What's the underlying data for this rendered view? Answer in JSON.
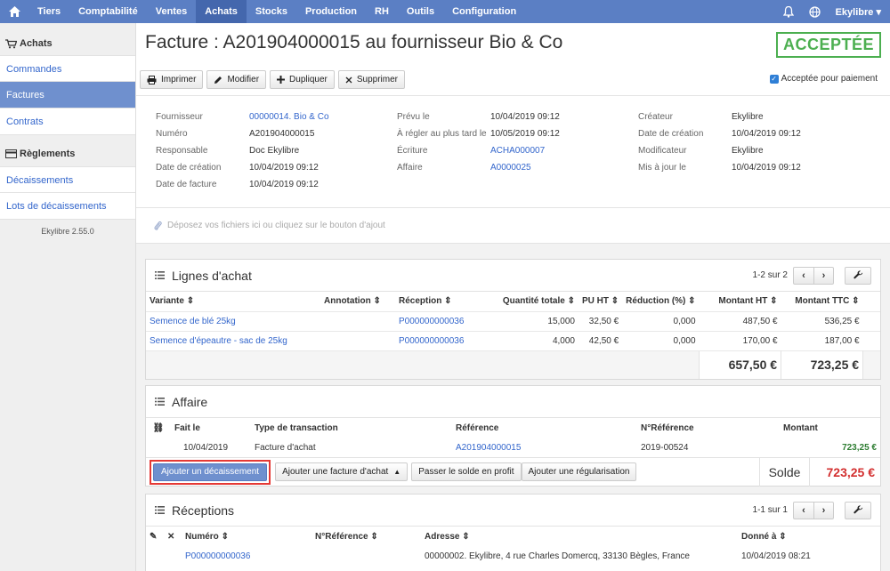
{
  "nav": {
    "items": [
      "Tiers",
      "Comptabilité",
      "Ventes",
      "Achats",
      "Stocks",
      "Production",
      "RH",
      "Outils",
      "Configuration"
    ],
    "active": "Achats",
    "user": "Ekylibre"
  },
  "sidebar": {
    "achats_title": "Achats",
    "achats_items": [
      "Commandes",
      "Factures",
      "Contrats"
    ],
    "reglements_title": "Règlements",
    "reglements_items": [
      "Décaissements",
      "Lots de décaissements"
    ],
    "version": "Ekylibre 2.55.0"
  },
  "header": {
    "title": "Facture : A201904000015 au fournisseur Bio & Co",
    "status": "ACCEPTÉE",
    "buttons": {
      "print": "Imprimer",
      "edit": "Modifier",
      "duplicate": "Dupliquer",
      "delete": "Supprimer"
    },
    "accepted_for_payment": "Acceptée pour paiement"
  },
  "details": {
    "col1": [
      {
        "label": "Fournisseur",
        "value": "00000014. Bio & Co",
        "link": true
      },
      {
        "label": "Numéro",
        "value": "A201904000015",
        "link": false
      },
      {
        "label": "Responsable",
        "value": "Doc Ekylibre",
        "link": false
      },
      {
        "label": "Date de création",
        "value": "10/04/2019 09:12",
        "link": false
      },
      {
        "label": "Date de facture",
        "value": "10/04/2019 09:12",
        "link": false
      }
    ],
    "col2": [
      {
        "label": "Prévu le",
        "value": "10/04/2019 09:12",
        "link": false
      },
      {
        "label": "À régler au plus tard le",
        "value": "10/05/2019 09:12",
        "link": false
      },
      {
        "label": "Écriture",
        "value": "ACHA000007",
        "link": true
      },
      {
        "label": "Affaire",
        "value": "A0000025",
        "link": true
      }
    ],
    "col3": [
      {
        "label": "Créateur",
        "value": "Ekylibre",
        "link": false
      },
      {
        "label": "Date de création",
        "value": "10/04/2019 09:12",
        "link": false
      },
      {
        "label": "Modificateur",
        "value": "Ekylibre",
        "link": false
      },
      {
        "label": "Mis à jour le",
        "value": "10/04/2019 09:12",
        "link": false
      }
    ]
  },
  "dropzone": "Déposez vos fichiers ici ou cliquez sur le bouton d'ajout",
  "lines": {
    "title": "Lignes d'achat",
    "pager": "1-2 sur 2",
    "columns": [
      "Variante",
      "Annotation",
      "Réception",
      "Quantité totale",
      "PU HT",
      "Réduction (%)",
      "Montant HT",
      "Montant TTC"
    ],
    "rows": [
      [
        "Semence de blé 25kg",
        "",
        "P000000000036",
        "15,000",
        "32,50 €",
        "0,000",
        "487,50 €",
        "536,25 €"
      ],
      [
        "Semence d'épeautre - sac de 25kg",
        "",
        "P000000000036",
        "4,000",
        "42,50 €",
        "0,000",
        "170,00 €",
        "187,00 €"
      ]
    ],
    "total_ht": "657,50 €",
    "total_ttc": "723,25 €"
  },
  "affaire": {
    "title": "Affaire",
    "columns": [
      "Fait le",
      "Type de transaction",
      "Référence",
      "N°Référence",
      "Montant"
    ],
    "row": [
      "10/04/2019",
      "Facture d'achat",
      "A201904000015",
      "2019-00524",
      "723,25 €"
    ],
    "buttons": {
      "add_payment": "Ajouter un décaissement",
      "add_invoice": "Ajouter une facture d'achat",
      "profit": "Passer le solde en profit",
      "regularisation": "Ajouter une régularisation"
    },
    "balance_label": "Solde",
    "balance_value": "723,25 €"
  },
  "receptions": {
    "title": "Réceptions",
    "pager": "1-1 sur 1",
    "columns": [
      "Numéro",
      "N°Référence",
      "Adresse",
      "Donné à"
    ],
    "row": [
      "P000000000036",
      "",
      "00000002. Ekylibre, 4 rue Charles Domercq, 33130 Bègles, France",
      "10/04/2019 08:21"
    ]
  },
  "colors": {
    "nav": "#5b7fc4",
    "accent": "#3366cc",
    "accepted": "#4caf50",
    "balance": "#d32f2f",
    "highlight": "#e53935"
  }
}
